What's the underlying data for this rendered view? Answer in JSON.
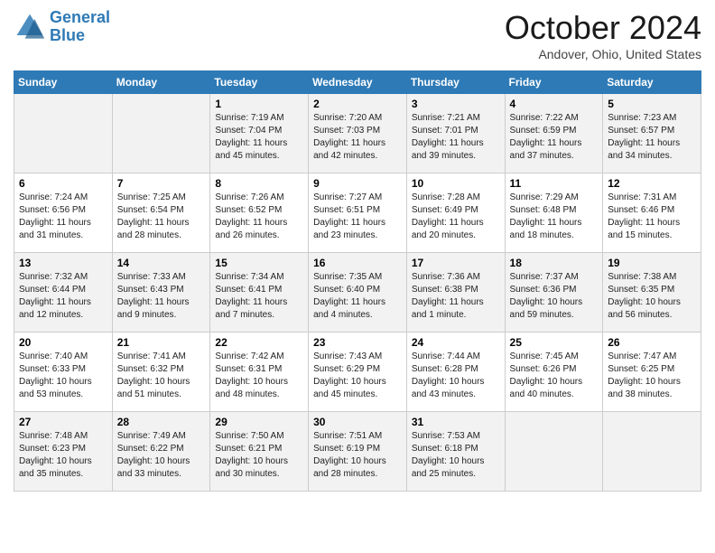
{
  "header": {
    "logo_line1": "General",
    "logo_line2": "Blue",
    "month": "October 2024",
    "location": "Andover, Ohio, United States"
  },
  "weekdays": [
    "Sunday",
    "Monday",
    "Tuesday",
    "Wednesday",
    "Thursday",
    "Friday",
    "Saturday"
  ],
  "weeks": [
    [
      {
        "day": "",
        "info": ""
      },
      {
        "day": "",
        "info": ""
      },
      {
        "day": "1",
        "info": "Sunrise: 7:19 AM\nSunset: 7:04 PM\nDaylight: 11 hours\nand 45 minutes."
      },
      {
        "day": "2",
        "info": "Sunrise: 7:20 AM\nSunset: 7:03 PM\nDaylight: 11 hours\nand 42 minutes."
      },
      {
        "day": "3",
        "info": "Sunrise: 7:21 AM\nSunset: 7:01 PM\nDaylight: 11 hours\nand 39 minutes."
      },
      {
        "day": "4",
        "info": "Sunrise: 7:22 AM\nSunset: 6:59 PM\nDaylight: 11 hours\nand 37 minutes."
      },
      {
        "day": "5",
        "info": "Sunrise: 7:23 AM\nSunset: 6:57 PM\nDaylight: 11 hours\nand 34 minutes."
      }
    ],
    [
      {
        "day": "6",
        "info": "Sunrise: 7:24 AM\nSunset: 6:56 PM\nDaylight: 11 hours\nand 31 minutes."
      },
      {
        "day": "7",
        "info": "Sunrise: 7:25 AM\nSunset: 6:54 PM\nDaylight: 11 hours\nand 28 minutes."
      },
      {
        "day": "8",
        "info": "Sunrise: 7:26 AM\nSunset: 6:52 PM\nDaylight: 11 hours\nand 26 minutes."
      },
      {
        "day": "9",
        "info": "Sunrise: 7:27 AM\nSunset: 6:51 PM\nDaylight: 11 hours\nand 23 minutes."
      },
      {
        "day": "10",
        "info": "Sunrise: 7:28 AM\nSunset: 6:49 PM\nDaylight: 11 hours\nand 20 minutes."
      },
      {
        "day": "11",
        "info": "Sunrise: 7:29 AM\nSunset: 6:48 PM\nDaylight: 11 hours\nand 18 minutes."
      },
      {
        "day": "12",
        "info": "Sunrise: 7:31 AM\nSunset: 6:46 PM\nDaylight: 11 hours\nand 15 minutes."
      }
    ],
    [
      {
        "day": "13",
        "info": "Sunrise: 7:32 AM\nSunset: 6:44 PM\nDaylight: 11 hours\nand 12 minutes."
      },
      {
        "day": "14",
        "info": "Sunrise: 7:33 AM\nSunset: 6:43 PM\nDaylight: 11 hours\nand 9 minutes."
      },
      {
        "day": "15",
        "info": "Sunrise: 7:34 AM\nSunset: 6:41 PM\nDaylight: 11 hours\nand 7 minutes."
      },
      {
        "day": "16",
        "info": "Sunrise: 7:35 AM\nSunset: 6:40 PM\nDaylight: 11 hours\nand 4 minutes."
      },
      {
        "day": "17",
        "info": "Sunrise: 7:36 AM\nSunset: 6:38 PM\nDaylight: 11 hours\nand 1 minute."
      },
      {
        "day": "18",
        "info": "Sunrise: 7:37 AM\nSunset: 6:36 PM\nDaylight: 10 hours\nand 59 minutes."
      },
      {
        "day": "19",
        "info": "Sunrise: 7:38 AM\nSunset: 6:35 PM\nDaylight: 10 hours\nand 56 minutes."
      }
    ],
    [
      {
        "day": "20",
        "info": "Sunrise: 7:40 AM\nSunset: 6:33 PM\nDaylight: 10 hours\nand 53 minutes."
      },
      {
        "day": "21",
        "info": "Sunrise: 7:41 AM\nSunset: 6:32 PM\nDaylight: 10 hours\nand 51 minutes."
      },
      {
        "day": "22",
        "info": "Sunrise: 7:42 AM\nSunset: 6:31 PM\nDaylight: 10 hours\nand 48 minutes."
      },
      {
        "day": "23",
        "info": "Sunrise: 7:43 AM\nSunset: 6:29 PM\nDaylight: 10 hours\nand 45 minutes."
      },
      {
        "day": "24",
        "info": "Sunrise: 7:44 AM\nSunset: 6:28 PM\nDaylight: 10 hours\nand 43 minutes."
      },
      {
        "day": "25",
        "info": "Sunrise: 7:45 AM\nSunset: 6:26 PM\nDaylight: 10 hours\nand 40 minutes."
      },
      {
        "day": "26",
        "info": "Sunrise: 7:47 AM\nSunset: 6:25 PM\nDaylight: 10 hours\nand 38 minutes."
      }
    ],
    [
      {
        "day": "27",
        "info": "Sunrise: 7:48 AM\nSunset: 6:23 PM\nDaylight: 10 hours\nand 35 minutes."
      },
      {
        "day": "28",
        "info": "Sunrise: 7:49 AM\nSunset: 6:22 PM\nDaylight: 10 hours\nand 33 minutes."
      },
      {
        "day": "29",
        "info": "Sunrise: 7:50 AM\nSunset: 6:21 PM\nDaylight: 10 hours\nand 30 minutes."
      },
      {
        "day": "30",
        "info": "Sunrise: 7:51 AM\nSunset: 6:19 PM\nDaylight: 10 hours\nand 28 minutes."
      },
      {
        "day": "31",
        "info": "Sunrise: 7:53 AM\nSunset: 6:18 PM\nDaylight: 10 hours\nand 25 minutes."
      },
      {
        "day": "",
        "info": ""
      },
      {
        "day": "",
        "info": ""
      }
    ]
  ]
}
